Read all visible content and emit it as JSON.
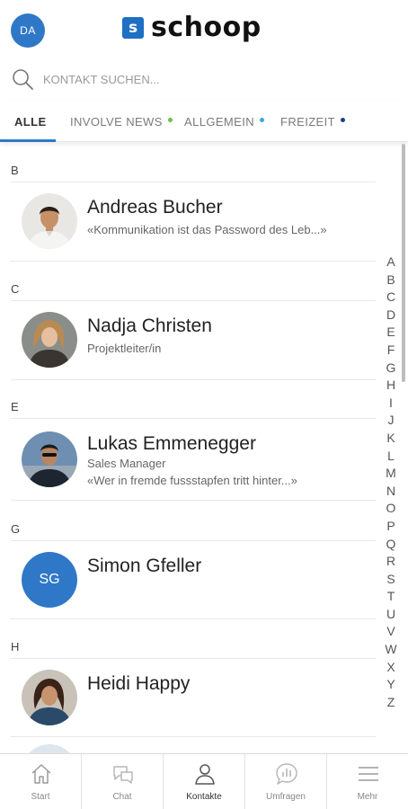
{
  "header": {
    "avatar_initials": "DA",
    "logo_text": "schoop",
    "logo_mark": "s"
  },
  "search": {
    "placeholder": "KONTAKT SUCHEN..."
  },
  "tabs": [
    {
      "label": "ALLE",
      "active": true
    },
    {
      "label": "INVOLVE NEWS",
      "dot_color": "#6cc04a"
    },
    {
      "label": "ALLGEMEIN",
      "dot_color": "#3aa9e0"
    },
    {
      "label": "FREIZEIT",
      "dot_color": "#1f3c88"
    }
  ],
  "sections": [
    {
      "letter": "B",
      "contacts": [
        {
          "name": "Andreas Bucher",
          "subtitle": "«Kommunikation ist das Password des Leb...»"
        }
      ]
    },
    {
      "letter": "C",
      "contacts": [
        {
          "name": "Nadja Christen",
          "subtitle": "Projektleiter/in"
        }
      ]
    },
    {
      "letter": "E",
      "contacts": [
        {
          "name": "Lukas Emmenegger",
          "subtitle": "Sales Manager",
          "subtitle2": "«Wer in fremde fussstapfen tritt hinter...»"
        }
      ]
    },
    {
      "letter": "G",
      "contacts": [
        {
          "name": "Simon Gfeller",
          "initials": "SG"
        }
      ]
    },
    {
      "letter": "H",
      "contacts": [
        {
          "name": "Heidi Happy"
        }
      ]
    }
  ],
  "alphabet": [
    "A",
    "B",
    "C",
    "D",
    "E",
    "F",
    "G",
    "H",
    "I",
    "J",
    "K",
    "L",
    "M",
    "N",
    "O",
    "P",
    "Q",
    "R",
    "S",
    "T",
    "U",
    "V",
    "W",
    "X",
    "Y",
    "Z"
  ],
  "bottom_nav": [
    {
      "label": "Start",
      "icon": "home-icon"
    },
    {
      "label": "Chat",
      "icon": "chat-icon"
    },
    {
      "label": "Kontakte",
      "icon": "person-icon",
      "active": true
    },
    {
      "label": "Umfragen",
      "icon": "poll-icon"
    },
    {
      "label": "Mehr",
      "icon": "menu-icon"
    }
  ],
  "colors": {
    "accent": "#2f78c8",
    "logo_blue": "#1f6fc4"
  }
}
